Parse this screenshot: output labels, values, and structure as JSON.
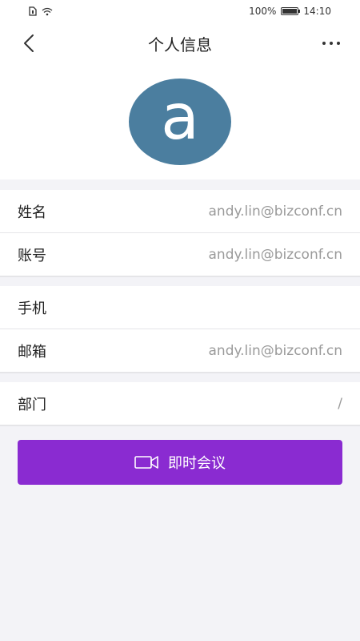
{
  "status_bar": {
    "battery_text": "100%",
    "time": "14:10"
  },
  "header": {
    "title": "个人信息"
  },
  "avatar": {
    "letter": "a",
    "color": "#4b7e9f"
  },
  "groups": [
    {
      "rows": [
        {
          "label": "姓名",
          "value": "andy.lin@bizconf.cn"
        },
        {
          "label": "账号",
          "value": "andy.lin@bizconf.cn"
        }
      ]
    },
    {
      "rows": [
        {
          "label": "手机",
          "value": ""
        },
        {
          "label": "邮箱",
          "value": "andy.lin@bizconf.cn"
        }
      ]
    },
    {
      "rows": [
        {
          "label": "部门",
          "value": "/"
        }
      ]
    }
  ],
  "action_button": {
    "label": "即时会议",
    "icon": "video-camera-icon",
    "color": "#8a2bd1"
  }
}
